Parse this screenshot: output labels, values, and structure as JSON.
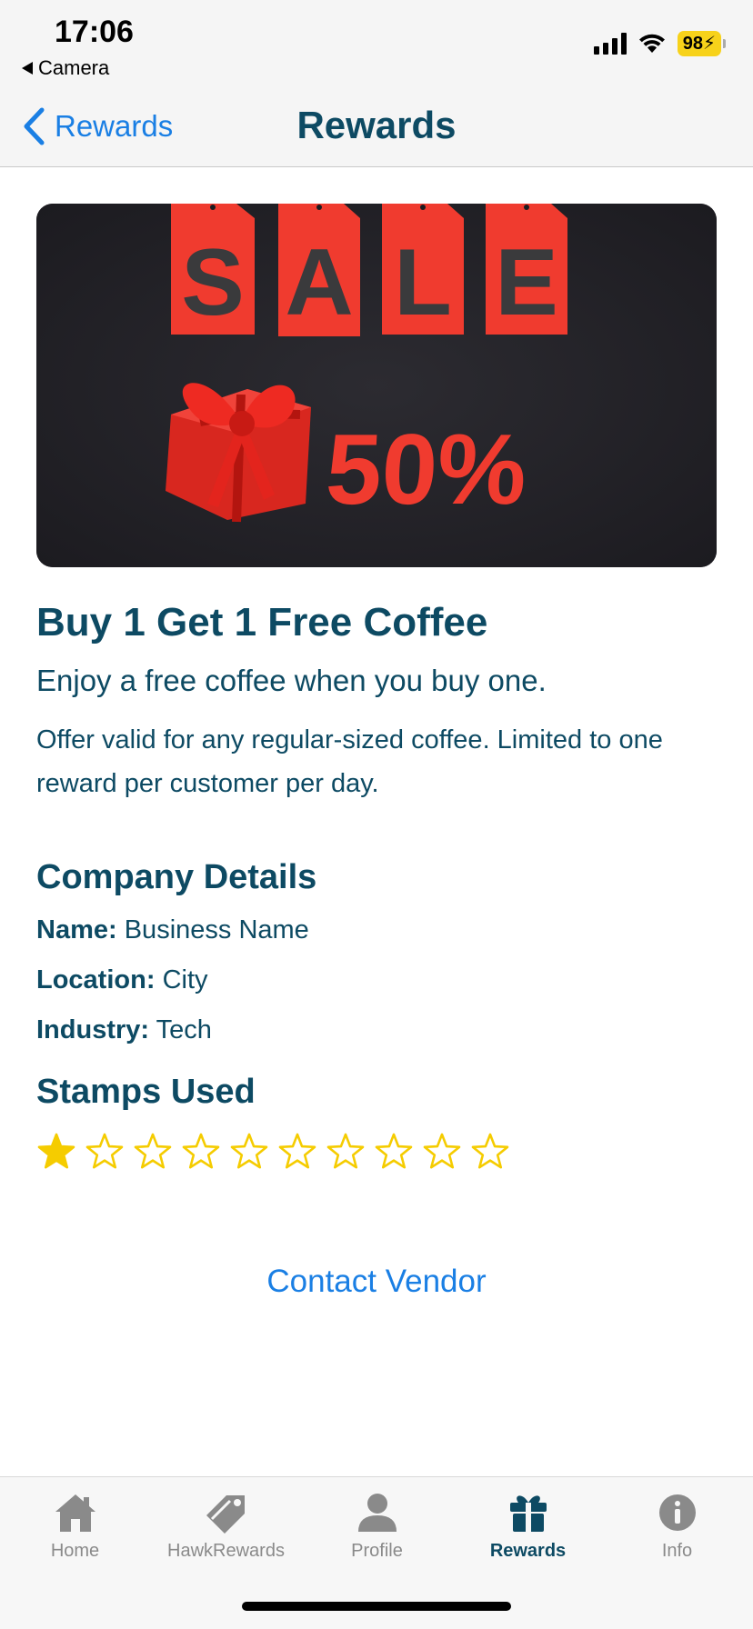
{
  "status_bar": {
    "time": "17:06",
    "back_app": "Camera",
    "battery": "98"
  },
  "nav": {
    "back_label": "Rewards",
    "title": "Rewards"
  },
  "banner": {
    "sale_letters": [
      "S",
      "A",
      "L",
      "E"
    ],
    "discount": "50%",
    "colors": {
      "background": "#222126",
      "accent": "#f03b2f",
      "letters": "#3a3a3c"
    }
  },
  "offer": {
    "title": "Buy 1 Get 1 Free Coffee",
    "subtitle": "Enjoy a free coffee when you buy one.",
    "description": "Offer valid for any regular-sized coffee. Limited to one reward per customer per day."
  },
  "company": {
    "heading": "Company Details",
    "name_label": "Name:",
    "name_value": "Business Name",
    "location_label": "Location:",
    "location_value": "City",
    "industry_label": "Industry:",
    "industry_value": "Tech"
  },
  "stamps": {
    "heading": "Stamps Used",
    "used": 1,
    "total": 10,
    "color": "#f5cc00"
  },
  "contact_label": "Contact Vendor",
  "tabs": [
    {
      "label": "Home",
      "icon": "house-icon"
    },
    {
      "label": "HawkRewards",
      "icon": "tag-icon"
    },
    {
      "label": "Profile",
      "icon": "person-icon"
    },
    {
      "label": "Rewards",
      "icon": "gift-icon",
      "active": true
    },
    {
      "label": "Info",
      "icon": "info-icon"
    }
  ],
  "colors": {
    "primary_text": "#0d4a63",
    "link": "#1a7fe4",
    "tab_inactive": "#8a8a8a"
  }
}
